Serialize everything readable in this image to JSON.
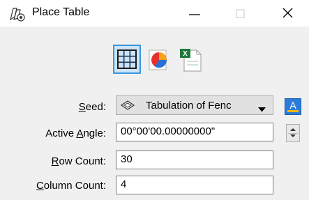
{
  "window": {
    "title": "Place Table",
    "icon": "place-table-app-icon",
    "controls": [
      "minimize",
      "maximize",
      "close"
    ]
  },
  "mode_toolbar": {
    "buttons": [
      {
        "icon": "table-grid-icon",
        "selected": true
      },
      {
        "icon": "pie-chart-icon",
        "selected": false
      },
      {
        "icon": "excel-file-icon",
        "selected": false
      }
    ]
  },
  "form": {
    "seed": {
      "label_pre": "",
      "label_key": "S",
      "label_post": "eed:",
      "value": "Tabulation of Fenc",
      "icon": "seed-icon"
    },
    "active_angle": {
      "label_pre": "Active ",
      "label_key": "A",
      "label_post": "ngle:",
      "value": "00°00'00.00000000\""
    },
    "row_count": {
      "label_pre": "",
      "label_key": "R",
      "label_post": "ow Count:",
      "value": "30"
    },
    "column_count": {
      "label_pre": "",
      "label_key": "C",
      "label_post": "olumn Count:",
      "value": "4"
    }
  },
  "colors": {
    "selected_border": "#0078d7",
    "selected_fill": "#cce4f7",
    "text_style_accent": "#2b7bd8"
  }
}
